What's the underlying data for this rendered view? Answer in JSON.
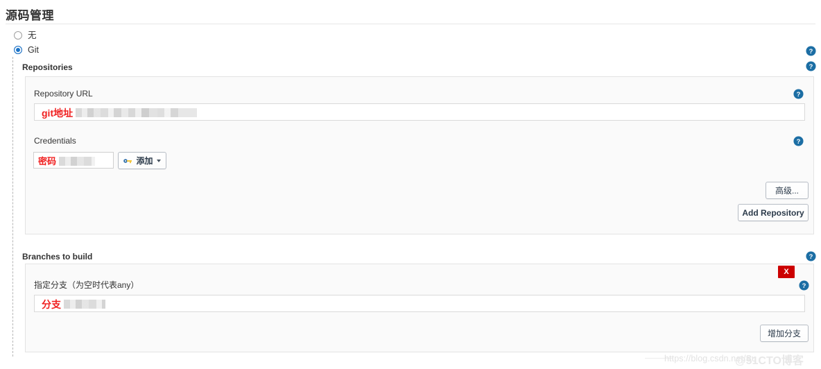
{
  "section": {
    "title": "源码管理"
  },
  "scm_options": [
    {
      "label": "无",
      "selected": false
    },
    {
      "label": "Git",
      "selected": true
    }
  ],
  "git": {
    "repositories_label": "Repositories",
    "repository_url": {
      "label": "Repository URL",
      "value": "git地址",
      "redacted": true
    },
    "credentials": {
      "label": "Credentials",
      "value": "密码",
      "redacted": true,
      "add_button": "添加"
    },
    "advanced_button": "高级...",
    "add_repository_button": "Add Repository",
    "branches_label": "Branches to build",
    "branch": {
      "label": "指定分支（为空时代表any）",
      "value": "分支",
      "redacted": true
    },
    "add_branch_button": "增加分支",
    "delete_branch_button": "X"
  },
  "icons": {
    "help": "help-icon",
    "key": "key-icon",
    "caret": "chevron-down-icon"
  },
  "colors": {
    "accent": "#1a73c8",
    "help_blue": "#1c6ea4",
    "danger": "#cc0000",
    "annotation_red": "#f02020",
    "panel_bg": "#fafafa",
    "panel_border": "#e3e3e3"
  },
  "watermark": {
    "url": "https://blog.csdn.net/Su",
    "brand": "@51CTO博客"
  }
}
